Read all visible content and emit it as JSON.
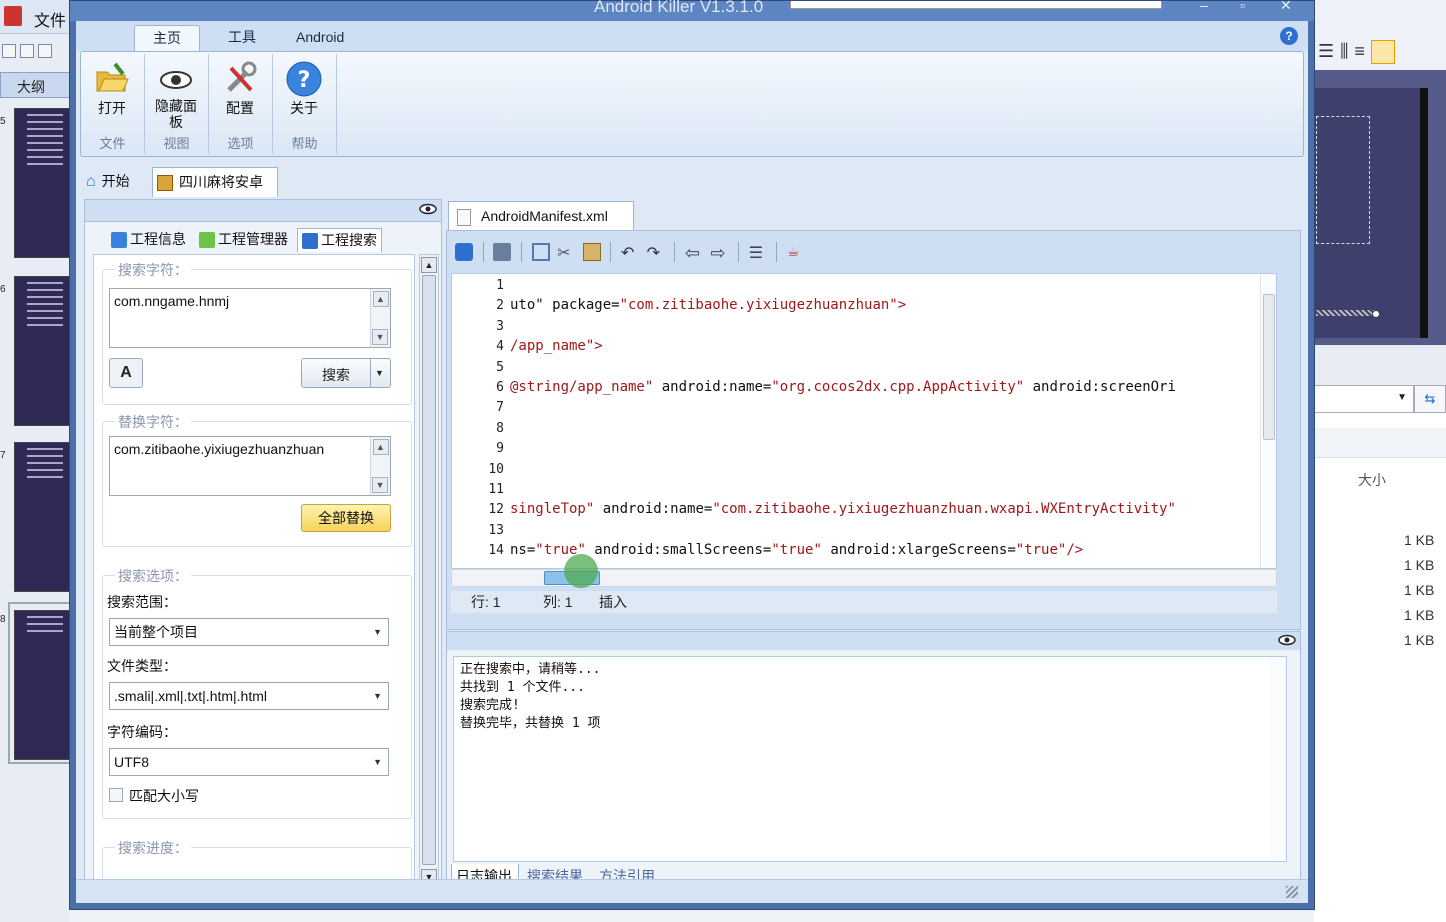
{
  "background_app": {
    "file_menu": "文件",
    "outline_tab": "大纲",
    "slide_numbers": [
      "5",
      "6",
      "7",
      "8"
    ],
    "right_column_header": "大小",
    "file_sizes": [
      "1 KB",
      "1 KB",
      "1 KB",
      "1 KB",
      "1 KB"
    ]
  },
  "window": {
    "title": "Android Killer V1.3.1.0"
  },
  "ribbon": {
    "tabs": [
      "主页",
      "工具",
      "Android"
    ],
    "active_tab": "主页",
    "groups": [
      {
        "label": "文件",
        "buttons": [
          {
            "label": "打开",
            "icon": "folder-open-icon"
          }
        ]
      },
      {
        "label": "视图",
        "buttons": [
          {
            "label": "隐藏面板",
            "icon": "eye-icon"
          }
        ]
      },
      {
        "label": "选项",
        "buttons": [
          {
            "label": "配置",
            "icon": "tools-icon"
          }
        ]
      },
      {
        "label": "帮助",
        "buttons": [
          {
            "label": "关于",
            "icon": "help-icon"
          }
        ]
      }
    ]
  },
  "doc_tabs": {
    "start": "开始",
    "project": "四川麻将安卓"
  },
  "left_panel": {
    "tabs": [
      "工程信息",
      "工程管理器",
      "工程搜索"
    ],
    "active_tab": "工程搜索",
    "search_section": "搜索字符：",
    "search_value": "com.nngame.hnmj",
    "search_button": "搜索",
    "replace_section": "替换字符：",
    "replace_value": "com.zitibaohe.yixiugezhuanzhuan",
    "replace_all_button": "全部替换",
    "options_section": "搜索选项：",
    "scope_label": "搜索范围：",
    "scope_value": "当前整个项目",
    "filetype_label": "文件类型：",
    "filetype_value": ".smali|.xml|.txt|.htm|.html",
    "encoding_label": "字符编码：",
    "encoding_value": "UTF8",
    "match_case_label": "匹配大小写",
    "match_case_checked": false,
    "progress_section": "搜索进度："
  },
  "editor": {
    "file_tab": "AndroidManifest.xml",
    "lines": [
      {
        "n": "1",
        "parts": []
      },
      {
        "n": "2",
        "parts": [
          {
            "t": "uto\" package=",
            "c": "att"
          },
          {
            "t": "\"com.zitibaohe.yixiugezhuanzhuan\">",
            "c": "str"
          }
        ]
      },
      {
        "n": "3",
        "parts": []
      },
      {
        "n": "4",
        "parts": [
          {
            "t": "/app_name\">",
            "c": "str"
          }
        ]
      },
      {
        "n": "5",
        "parts": []
      },
      {
        "n": "6",
        "parts": [
          {
            "t": "@string/app_name\"",
            "c": "str"
          },
          {
            "t": " android:name=",
            "c": "att"
          },
          {
            "t": "\"org.cocos2dx.cpp.AppActivity\"",
            "c": "str"
          },
          {
            "t": " android:screenOri",
            "c": "att"
          }
        ]
      },
      {
        "n": "7",
        "parts": []
      },
      {
        "n": "8",
        "parts": []
      },
      {
        "n": "9",
        "parts": []
      },
      {
        "n": "10",
        "parts": []
      },
      {
        "n": "11",
        "parts": []
      },
      {
        "n": "12",
        "parts": [
          {
            "t": "singleTop\"",
            "c": "str"
          },
          {
            "t": " android:name=",
            "c": "att"
          },
          {
            "t": "\"com.zitibaohe.yixiugezhuanzhuan.wxapi.WXEntryActivity\"",
            "c": "str"
          }
        ]
      },
      {
        "n": "13",
        "parts": []
      },
      {
        "n": "14",
        "parts": [
          {
            "t": "ns=",
            "c": "att"
          },
          {
            "t": "\"true\"",
            "c": "str"
          },
          {
            "t": " android:smallScreens=",
            "c": "att"
          },
          {
            "t": "\"true\"",
            "c": "str"
          },
          {
            "t": " android:xlargeScreens=",
            "c": "att"
          },
          {
            "t": "\"true\"",
            "c": "str"
          },
          {
            "t": "/>",
            "c": "str"
          }
        ]
      }
    ],
    "status_row": "行: 1",
    "status_col": "列: 1",
    "status_mode": "插入"
  },
  "output": {
    "lines": [
      "正在搜索中，请稍等...",
      "共找到 1 个文件...",
      "搜索完成!",
      "替换完毕，共替换 1 项"
    ],
    "tabs": [
      "日志输出",
      "搜索结果",
      "方法引用"
    ],
    "active_tab": "日志输出"
  },
  "colors": {
    "accent": "#4b6fa8",
    "code_string": "#a11818"
  }
}
